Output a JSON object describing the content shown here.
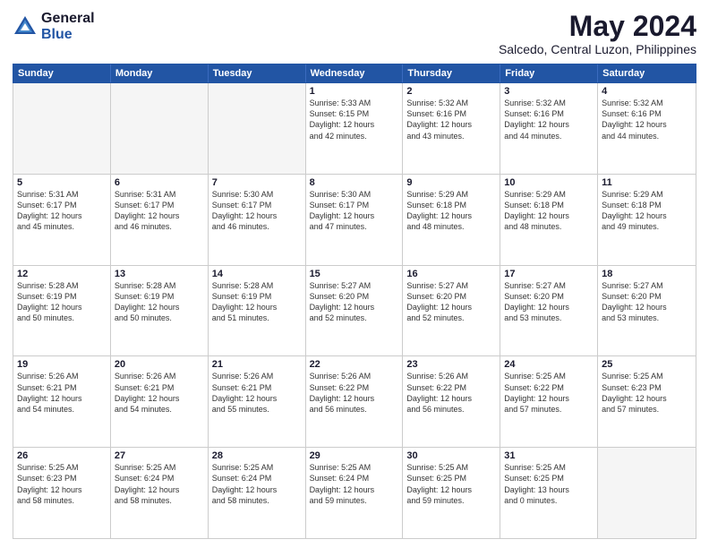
{
  "logo": {
    "general": "General",
    "blue": "Blue"
  },
  "title": {
    "month_year": "May 2024",
    "location": "Salcedo, Central Luzon, Philippines"
  },
  "weekdays": [
    "Sunday",
    "Monday",
    "Tuesday",
    "Wednesday",
    "Thursday",
    "Friday",
    "Saturday"
  ],
  "rows": [
    [
      {
        "day": "",
        "info": "",
        "empty": true
      },
      {
        "day": "",
        "info": "",
        "empty": true
      },
      {
        "day": "",
        "info": "",
        "empty": true
      },
      {
        "day": "1",
        "info": "Sunrise: 5:33 AM\nSunset: 6:15 PM\nDaylight: 12 hours\nand 42 minutes.",
        "empty": false
      },
      {
        "day": "2",
        "info": "Sunrise: 5:32 AM\nSunset: 6:16 PM\nDaylight: 12 hours\nand 43 minutes.",
        "empty": false
      },
      {
        "day": "3",
        "info": "Sunrise: 5:32 AM\nSunset: 6:16 PM\nDaylight: 12 hours\nand 44 minutes.",
        "empty": false
      },
      {
        "day": "4",
        "info": "Sunrise: 5:32 AM\nSunset: 6:16 PM\nDaylight: 12 hours\nand 44 minutes.",
        "empty": false
      }
    ],
    [
      {
        "day": "5",
        "info": "Sunrise: 5:31 AM\nSunset: 6:17 PM\nDaylight: 12 hours\nand 45 minutes.",
        "empty": false
      },
      {
        "day": "6",
        "info": "Sunrise: 5:31 AM\nSunset: 6:17 PM\nDaylight: 12 hours\nand 46 minutes.",
        "empty": false
      },
      {
        "day": "7",
        "info": "Sunrise: 5:30 AM\nSunset: 6:17 PM\nDaylight: 12 hours\nand 46 minutes.",
        "empty": false
      },
      {
        "day": "8",
        "info": "Sunrise: 5:30 AM\nSunset: 6:17 PM\nDaylight: 12 hours\nand 47 minutes.",
        "empty": false
      },
      {
        "day": "9",
        "info": "Sunrise: 5:29 AM\nSunset: 6:18 PM\nDaylight: 12 hours\nand 48 minutes.",
        "empty": false
      },
      {
        "day": "10",
        "info": "Sunrise: 5:29 AM\nSunset: 6:18 PM\nDaylight: 12 hours\nand 48 minutes.",
        "empty": false
      },
      {
        "day": "11",
        "info": "Sunrise: 5:29 AM\nSunset: 6:18 PM\nDaylight: 12 hours\nand 49 minutes.",
        "empty": false
      }
    ],
    [
      {
        "day": "12",
        "info": "Sunrise: 5:28 AM\nSunset: 6:19 PM\nDaylight: 12 hours\nand 50 minutes.",
        "empty": false
      },
      {
        "day": "13",
        "info": "Sunrise: 5:28 AM\nSunset: 6:19 PM\nDaylight: 12 hours\nand 50 minutes.",
        "empty": false
      },
      {
        "day": "14",
        "info": "Sunrise: 5:28 AM\nSunset: 6:19 PM\nDaylight: 12 hours\nand 51 minutes.",
        "empty": false
      },
      {
        "day": "15",
        "info": "Sunrise: 5:27 AM\nSunset: 6:20 PM\nDaylight: 12 hours\nand 52 minutes.",
        "empty": false
      },
      {
        "day": "16",
        "info": "Sunrise: 5:27 AM\nSunset: 6:20 PM\nDaylight: 12 hours\nand 52 minutes.",
        "empty": false
      },
      {
        "day": "17",
        "info": "Sunrise: 5:27 AM\nSunset: 6:20 PM\nDaylight: 12 hours\nand 53 minutes.",
        "empty": false
      },
      {
        "day": "18",
        "info": "Sunrise: 5:27 AM\nSunset: 6:20 PM\nDaylight: 12 hours\nand 53 minutes.",
        "empty": false
      }
    ],
    [
      {
        "day": "19",
        "info": "Sunrise: 5:26 AM\nSunset: 6:21 PM\nDaylight: 12 hours\nand 54 minutes.",
        "empty": false
      },
      {
        "day": "20",
        "info": "Sunrise: 5:26 AM\nSunset: 6:21 PM\nDaylight: 12 hours\nand 54 minutes.",
        "empty": false
      },
      {
        "day": "21",
        "info": "Sunrise: 5:26 AM\nSunset: 6:21 PM\nDaylight: 12 hours\nand 55 minutes.",
        "empty": false
      },
      {
        "day": "22",
        "info": "Sunrise: 5:26 AM\nSunset: 6:22 PM\nDaylight: 12 hours\nand 56 minutes.",
        "empty": false
      },
      {
        "day": "23",
        "info": "Sunrise: 5:26 AM\nSunset: 6:22 PM\nDaylight: 12 hours\nand 56 minutes.",
        "empty": false
      },
      {
        "day": "24",
        "info": "Sunrise: 5:25 AM\nSunset: 6:22 PM\nDaylight: 12 hours\nand 57 minutes.",
        "empty": false
      },
      {
        "day": "25",
        "info": "Sunrise: 5:25 AM\nSunset: 6:23 PM\nDaylight: 12 hours\nand 57 minutes.",
        "empty": false
      }
    ],
    [
      {
        "day": "26",
        "info": "Sunrise: 5:25 AM\nSunset: 6:23 PM\nDaylight: 12 hours\nand 58 minutes.",
        "empty": false
      },
      {
        "day": "27",
        "info": "Sunrise: 5:25 AM\nSunset: 6:24 PM\nDaylight: 12 hours\nand 58 minutes.",
        "empty": false
      },
      {
        "day": "28",
        "info": "Sunrise: 5:25 AM\nSunset: 6:24 PM\nDaylight: 12 hours\nand 58 minutes.",
        "empty": false
      },
      {
        "day": "29",
        "info": "Sunrise: 5:25 AM\nSunset: 6:24 PM\nDaylight: 12 hours\nand 59 minutes.",
        "empty": false
      },
      {
        "day": "30",
        "info": "Sunrise: 5:25 AM\nSunset: 6:25 PM\nDaylight: 12 hours\nand 59 minutes.",
        "empty": false
      },
      {
        "day": "31",
        "info": "Sunrise: 5:25 AM\nSunset: 6:25 PM\nDaylight: 13 hours\nand 0 minutes.",
        "empty": false
      },
      {
        "day": "",
        "info": "",
        "empty": true
      }
    ]
  ]
}
